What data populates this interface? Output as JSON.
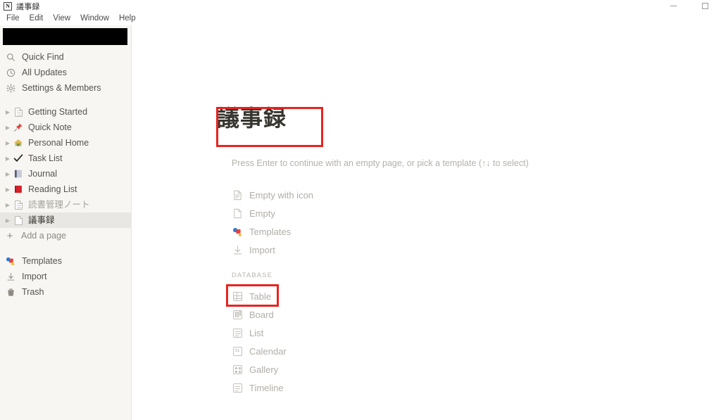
{
  "window": {
    "app_icon": "N",
    "title": "議事録",
    "controls": [
      {
        "name": "minimize-button",
        "glyph": "minimize"
      },
      {
        "name": "maximize-button",
        "glyph": "maximize"
      }
    ]
  },
  "menubar": {
    "items": [
      "File",
      "Edit",
      "View",
      "Window",
      "Help"
    ]
  },
  "sidebar": {
    "workspace_redacted": true,
    "nav_items": [
      {
        "label": "Quick Find",
        "icon": "search-icon"
      },
      {
        "label": "All Updates",
        "icon": "clock-icon"
      },
      {
        "label": "Settings & Members",
        "icon": "gear-icon"
      }
    ],
    "pages": [
      {
        "label": "Getting Started",
        "icon": "doc-icon",
        "selected": false,
        "dimmed": false
      },
      {
        "label": "Quick Note",
        "icon": "pin-icon",
        "selected": false,
        "dimmed": false
      },
      {
        "label": "Personal Home",
        "icon": "house-icon",
        "selected": false,
        "dimmed": false
      },
      {
        "label": "Task List",
        "icon": "check-icon",
        "selected": false,
        "dimmed": false
      },
      {
        "label": "Journal",
        "icon": "notebook-icon",
        "selected": false,
        "dimmed": false
      },
      {
        "label": "Reading List",
        "icon": "book-icon",
        "selected": false,
        "dimmed": false
      },
      {
        "label": "読書管理ノート",
        "icon": "doc-icon",
        "selected": false,
        "dimmed": true
      },
      {
        "label": "議事録",
        "icon": "doc-icon",
        "selected": true,
        "dimmed": false
      }
    ],
    "add_page_label": "Add a page",
    "bottom_items": [
      {
        "label": "Templates",
        "icon": "templates-icon"
      },
      {
        "label": "Import",
        "icon": "import-icon"
      },
      {
        "label": "Trash",
        "icon": "trash-icon"
      }
    ]
  },
  "main": {
    "page_title": "議事録",
    "hint": "Press Enter to continue with an empty page, or pick a template (↑↓ to select)",
    "options": [
      {
        "label": "Empty with icon",
        "icon": "doc-lines-icon"
      },
      {
        "label": "Empty",
        "icon": "doc-blank-icon"
      },
      {
        "label": "Templates",
        "icon": "templates-color-icon"
      },
      {
        "label": "Import",
        "icon": "import-arrow-icon"
      }
    ],
    "database_label": "DATABASE",
    "database_options": [
      {
        "label": "Table",
        "icon": "table-icon"
      },
      {
        "label": "Board",
        "icon": "board-icon"
      },
      {
        "label": "List",
        "icon": "list-icon"
      },
      {
        "label": "Calendar",
        "icon": "calendar-icon",
        "day": "31"
      },
      {
        "label": "Gallery",
        "icon": "gallery-icon"
      },
      {
        "label": "Timeline",
        "icon": "timeline-icon"
      }
    ]
  },
  "annotations": {
    "color": "#e8241f",
    "boxes": [
      "page-title",
      "database-table-option"
    ]
  }
}
